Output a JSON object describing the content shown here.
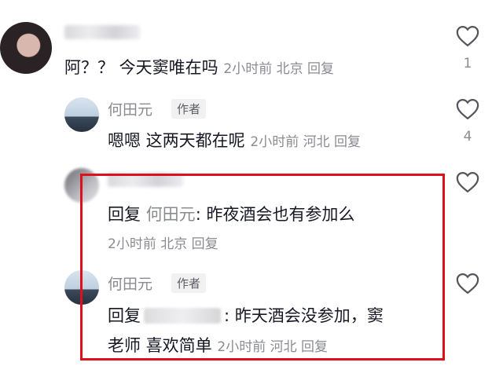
{
  "comments": [
    {
      "text": "阿？？ 今天窦唯在吗",
      "time": "2小时前",
      "location": "北京",
      "reply_label": "回复",
      "likes": "1"
    },
    {
      "username": "何田元",
      "author_badge": "作者",
      "text": "嗯嗯 这两天都在呢",
      "time": "2小时前",
      "location": "河北",
      "reply_label": "回复",
      "likes": "4"
    },
    {
      "reply_prefix": "回复",
      "reply_to": "何田元",
      "text": ": 昨夜酒会也有参加么",
      "time": "2小时前",
      "location": "北京",
      "reply_label": "回复"
    },
    {
      "username": "何田元",
      "author_badge": "作者",
      "reply_prefix": "回复",
      "text_line1": ": 昨天酒会没参加，窦",
      "text_line2": "老师 喜欢简单",
      "time": "2小时前",
      "location": "河北",
      "reply_label": "回复"
    }
  ],
  "colors": {
    "highlight": "#e00f1c",
    "meta": "#8a8b91",
    "text": "#161823"
  }
}
